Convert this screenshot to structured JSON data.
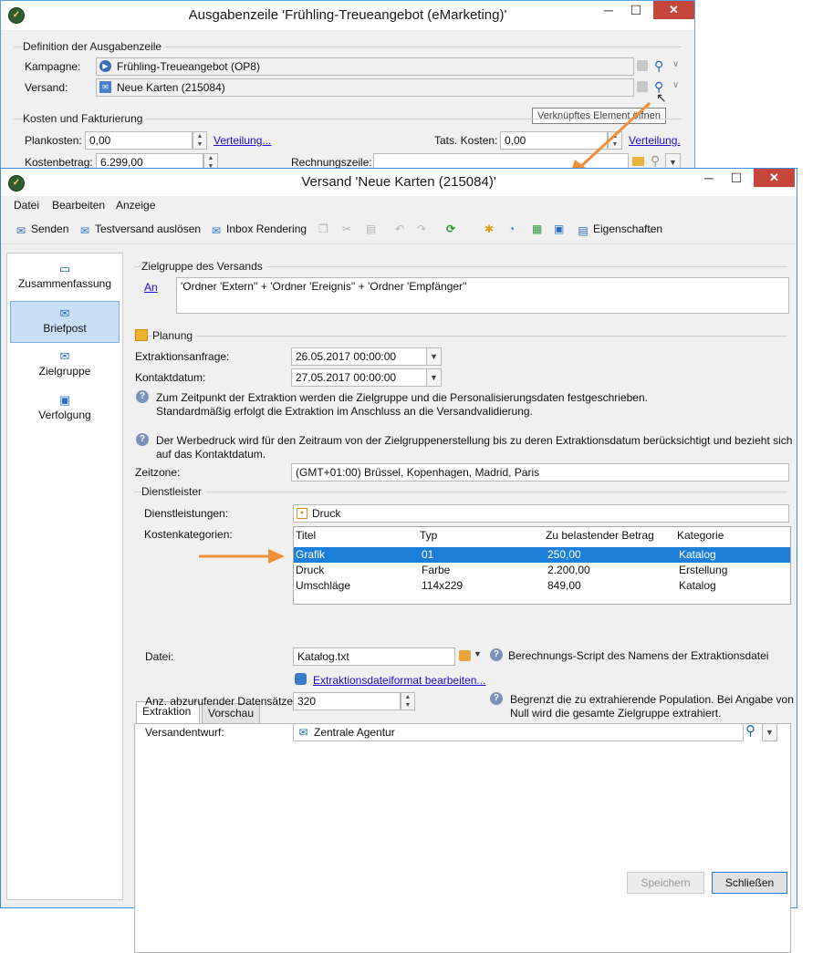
{
  "bg_window": {
    "title": "Ausgabenzeile 'Frühling-Treueangebot (eMarketing)'",
    "group_definition": "Definition der Ausgabenzeile",
    "campaign_label": "Kampagne:",
    "campaign_value": "Frühling-Treueangebot (OP8)",
    "delivery_label": "Versand:",
    "delivery_value": "Neue Karten (215084)",
    "tooltip": "Verknüpftes Element öffnen",
    "group_costs": "Kosten und Fakturierung",
    "planned_cost_label": "Plankosten:",
    "planned_cost_value": "0,00",
    "distribution_link": "Verteilung...",
    "actual_cost_label": "Tats. Kosten:",
    "actual_cost_value": "0,00",
    "distribution_link2": "Verteilung.",
    "cost_amount_label": "Kostenbetrag:",
    "cost_amount_value": "6.299,00",
    "invoice_line_label": "Rechnungszeile:",
    "invoice_line_value": ""
  },
  "window": {
    "title": "Versand 'Neue Karten (215084)'",
    "menu": [
      "Datei",
      "Bearbeiten",
      "Anzeige"
    ],
    "toolbar": {
      "send": "Senden",
      "test_send": "Testversand auslösen",
      "inbox_rendering": "Inbox Rendering",
      "properties": "Eigenschaften"
    }
  },
  "sidebar": {
    "items": [
      {
        "label": "Zusammenfassung",
        "icon": "summary-icon"
      },
      {
        "label": "Briefpost",
        "icon": "mail-icon"
      },
      {
        "label": "Zielgruppe",
        "icon": "target-icon"
      },
      {
        "label": "Verfolgung",
        "icon": "tracking-icon"
      }
    ]
  },
  "target": {
    "group_label": "Zielgruppe des Versands",
    "to_link": "An",
    "to_value": "'Ordner 'Extern'' + 'Ordner 'Ereignis'' + 'Ordner 'Empfänger''"
  },
  "planning": {
    "group_label": "Planung",
    "extraction_label": "Extraktionsanfrage:",
    "extraction_value": "26.05.2017 00:00:00",
    "contact_label": "Kontaktdatum:",
    "contact_value": "27.05.2017 00:00:00",
    "info1_line1": "Zum Zeitpunkt der Extraktion werden die Zielgruppe und die Personalisierungsdaten festgeschrieben.",
    "info1_line2": "Standardmäßig erfolgt die Extraktion im Anschluss an die Versandvalidierung.",
    "info2_line1": "Der Werbedruck wird für den Zeitraum von der Zielgruppenerstellung bis zu deren Extraktionsdatum berücksichtigt und bezieht sich",
    "info2_line2": "auf das Kontaktdatum.",
    "timezone_label": "Zeitzone:",
    "timezone_value": "(GMT+01:00) Brüssel, Kopenhagen, Madrid, Paris"
  },
  "provider": {
    "group_label": "Dienstleister",
    "services_label": "Dienstleistungen:",
    "services_value": "Druck",
    "cost_categories_label": "Kostenkategorien:",
    "columns": [
      "Titel",
      "Typ",
      "Zu belastender Betrag",
      "Kategorie"
    ],
    "rows": [
      {
        "title": "Grafik",
        "type": "01",
        "amount": "250,00",
        "category": "Katalog"
      },
      {
        "title": "Druck",
        "type": "Farbe",
        "amount": "2.200,00",
        "category": "Erstellung"
      },
      {
        "title": "Umschläge",
        "type": "114x229",
        "amount": "849,00",
        "category": "Katalog"
      }
    ]
  },
  "tabs": [
    "Extraktion",
    "Vorschau"
  ],
  "extraction": {
    "file_label": "Datei:",
    "file_value": "Katalog.txt",
    "file_help": "Berechnungs-Script des Namens der Extraktionsdatei",
    "format_link": "Extraktionsdateiformat bearbeiten...",
    "records_label": "Anz. abzurufender Datensätze:",
    "records_value": "320",
    "records_help_line1": "Begrenzt die zu extrahierende Population. Bei Angabe von",
    "records_help_line2": "Null wird die gesamte Zielgruppe extrahiert.",
    "draft_label": "Versandentwurf:",
    "draft_value": "Zentrale Agentur"
  },
  "buttons": {
    "save": "Speichern",
    "close": "Schließen"
  },
  "colors": {
    "accent": "#1e7fd8",
    "arrow": "#f0903a",
    "close_button": "#c7463c"
  }
}
